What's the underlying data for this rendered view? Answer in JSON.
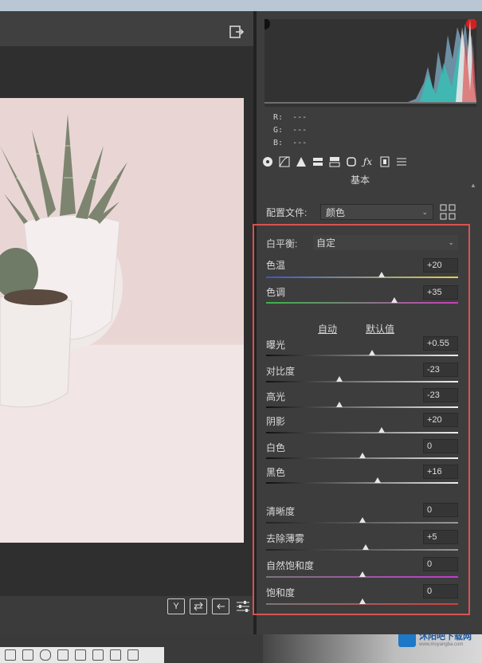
{
  "histogram_readout": {
    "r_label": "R:",
    "g_label": "G:",
    "b_label": "B:",
    "r_value": "---",
    "g_value": "---",
    "b_value": "---"
  },
  "section": {
    "title": "基本"
  },
  "profile": {
    "label": "配置文件:",
    "value": "颜色"
  },
  "white_balance": {
    "label": "白平衡:",
    "value": "自定"
  },
  "links": {
    "auto": "自动",
    "default": "默认值"
  },
  "sliders": [
    {
      "label": "色温",
      "value": "+20",
      "level": 0.6
    },
    {
      "label": "色调",
      "value": "+35",
      "level": 0.67
    },
    {
      "label": "曝光",
      "value": "+0.55",
      "level": 0.55
    },
    {
      "label": "对比度",
      "value": "-23",
      "level": 0.38
    },
    {
      "label": "高光",
      "value": "-23",
      "level": 0.38
    },
    {
      "label": "阴影",
      "value": "+20",
      "level": 0.6
    },
    {
      "label": "白色",
      "value": "0",
      "level": 0.5
    },
    {
      "label": "黑色",
      "value": "+16",
      "level": 0.58
    },
    {
      "label": "清晰度",
      "value": "0",
      "level": 0.5
    },
    {
      "label": "去除薄雾",
      "value": "+5",
      "level": 0.52
    },
    {
      "label": "自然饱和度",
      "value": "0",
      "level": 0.5
    },
    {
      "label": "饱和度",
      "value": "0",
      "level": 0.5
    }
  ],
  "toolbar_icons": [
    "basic-icon",
    "tone-curve-icon",
    "detail-icon",
    "hsl-icon",
    "split-toning-icon",
    "lens-icon",
    "fx-icon",
    "camera-calibration-icon",
    "presets-icon"
  ],
  "bottom_tools": {
    "y_label": "Y"
  },
  "watermark": {
    "brand": "沐阳吧下载网",
    "url": "www.muyangba.com"
  },
  "colors": {
    "red_highlight": "#d9534f",
    "panel_bg": "#3d3d3d"
  }
}
